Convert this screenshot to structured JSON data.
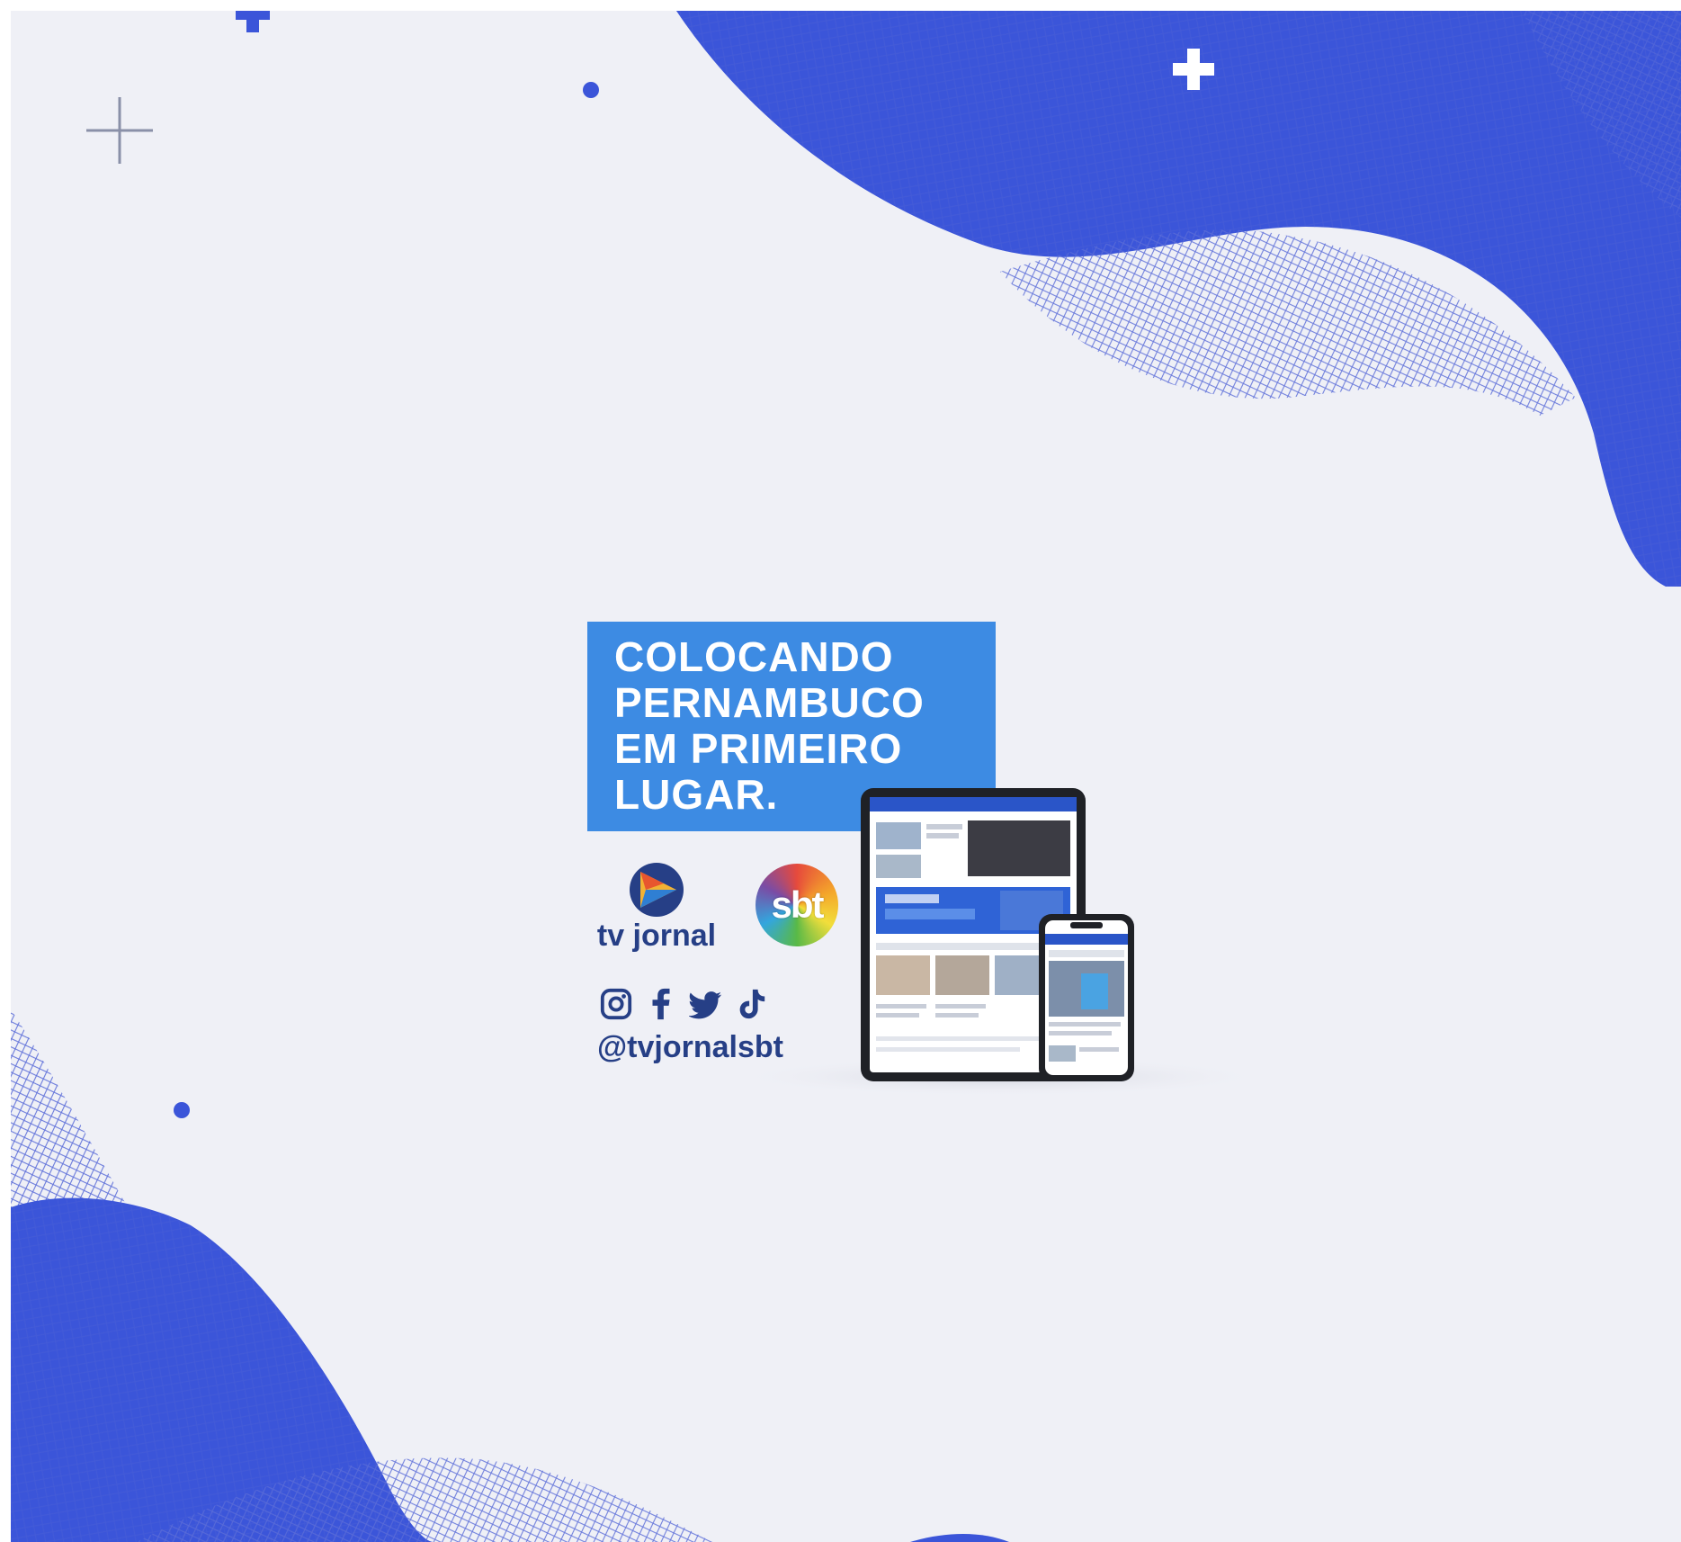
{
  "headline": {
    "lines": [
      "COLOCANDO",
      "PERNAMBUCO",
      "EM PRIMEIRO",
      "LUGAR."
    ]
  },
  "logos": {
    "tvjornal": "tv jornal",
    "sbt": "sbt"
  },
  "social": {
    "icons": [
      "instagram-icon",
      "facebook-icon",
      "twitter-icon",
      "tiktok-icon"
    ],
    "handle": "@tvjornalsbt"
  },
  "colors": {
    "background": "#eff0f6",
    "wave_blue": "#3b55d9",
    "headline_box": "#3d8be3",
    "text_navy": "#263f86"
  }
}
